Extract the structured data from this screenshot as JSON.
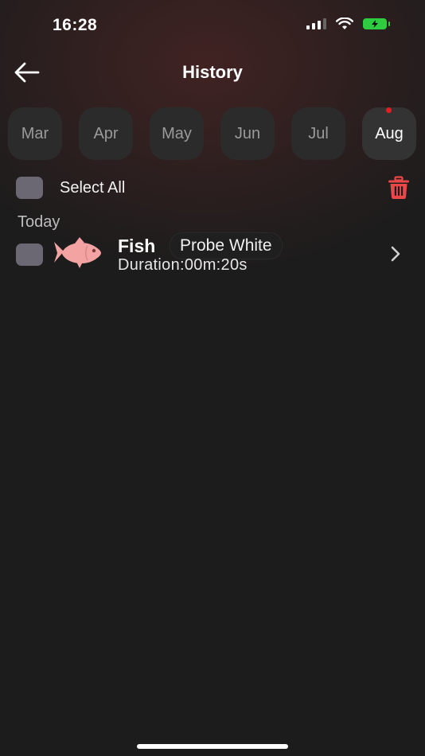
{
  "status_bar": {
    "time": "16:28",
    "battery_color": "#2ecc40"
  },
  "nav": {
    "title": "History",
    "back_icon": "arrow-left-icon"
  },
  "months": [
    {
      "label": "Mar",
      "active": false,
      "has_dot": false
    },
    {
      "label": "Apr",
      "active": false,
      "has_dot": false
    },
    {
      "label": "May",
      "active": false,
      "has_dot": false
    },
    {
      "label": "Jun",
      "active": false,
      "has_dot": false
    },
    {
      "label": "Jul",
      "active": false,
      "has_dot": false
    },
    {
      "label": "Aug",
      "active": true,
      "has_dot": true
    }
  ],
  "select_all": {
    "label": "Select All",
    "checked": false,
    "delete_icon": "trash-icon",
    "delete_color": "#e84848"
  },
  "sections": [
    {
      "title": "Today",
      "records": [
        {
          "name": "Fish",
          "probe": "Probe White",
          "duration": "Duration:00m:20s",
          "icon": "fish-icon",
          "icon_color": "#f4a3a3"
        }
      ]
    }
  ],
  "colors": {
    "accent_dot": "#e02020",
    "checkbox": "#6b6773"
  }
}
